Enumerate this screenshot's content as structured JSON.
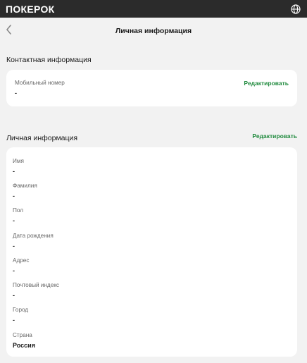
{
  "topbar": {
    "logo_text": "ПОКЕРОК",
    "language_icon": "globe-icon"
  },
  "header": {
    "back_icon": "chevron-left-icon",
    "title": "Личная информация"
  },
  "contact_section": {
    "title": "Контактная информация",
    "edit_label": "Редактировать",
    "fields": [
      {
        "label": "Мобильный номер",
        "value": "-"
      }
    ]
  },
  "personal_section": {
    "title": "Личная информация",
    "edit_label": "Редактировать",
    "fields": [
      {
        "label": "Имя",
        "value": "-"
      },
      {
        "label": "Фамилия",
        "value": "-"
      },
      {
        "label": "Пол",
        "value": "-"
      },
      {
        "label": "Дата рождения",
        "value": "-"
      },
      {
        "label": "Адрес",
        "value": "-"
      },
      {
        "label": "Почтовый индекс",
        "value": "-"
      },
      {
        "label": "Город",
        "value": "-"
      },
      {
        "label": "Страна",
        "value": "Россия"
      }
    ]
  },
  "colors": {
    "topbar_bg": "#2b2b2b",
    "page_bg": "#f2f2f2",
    "card_bg": "#ffffff",
    "accent_green": "#1f8a3d"
  }
}
